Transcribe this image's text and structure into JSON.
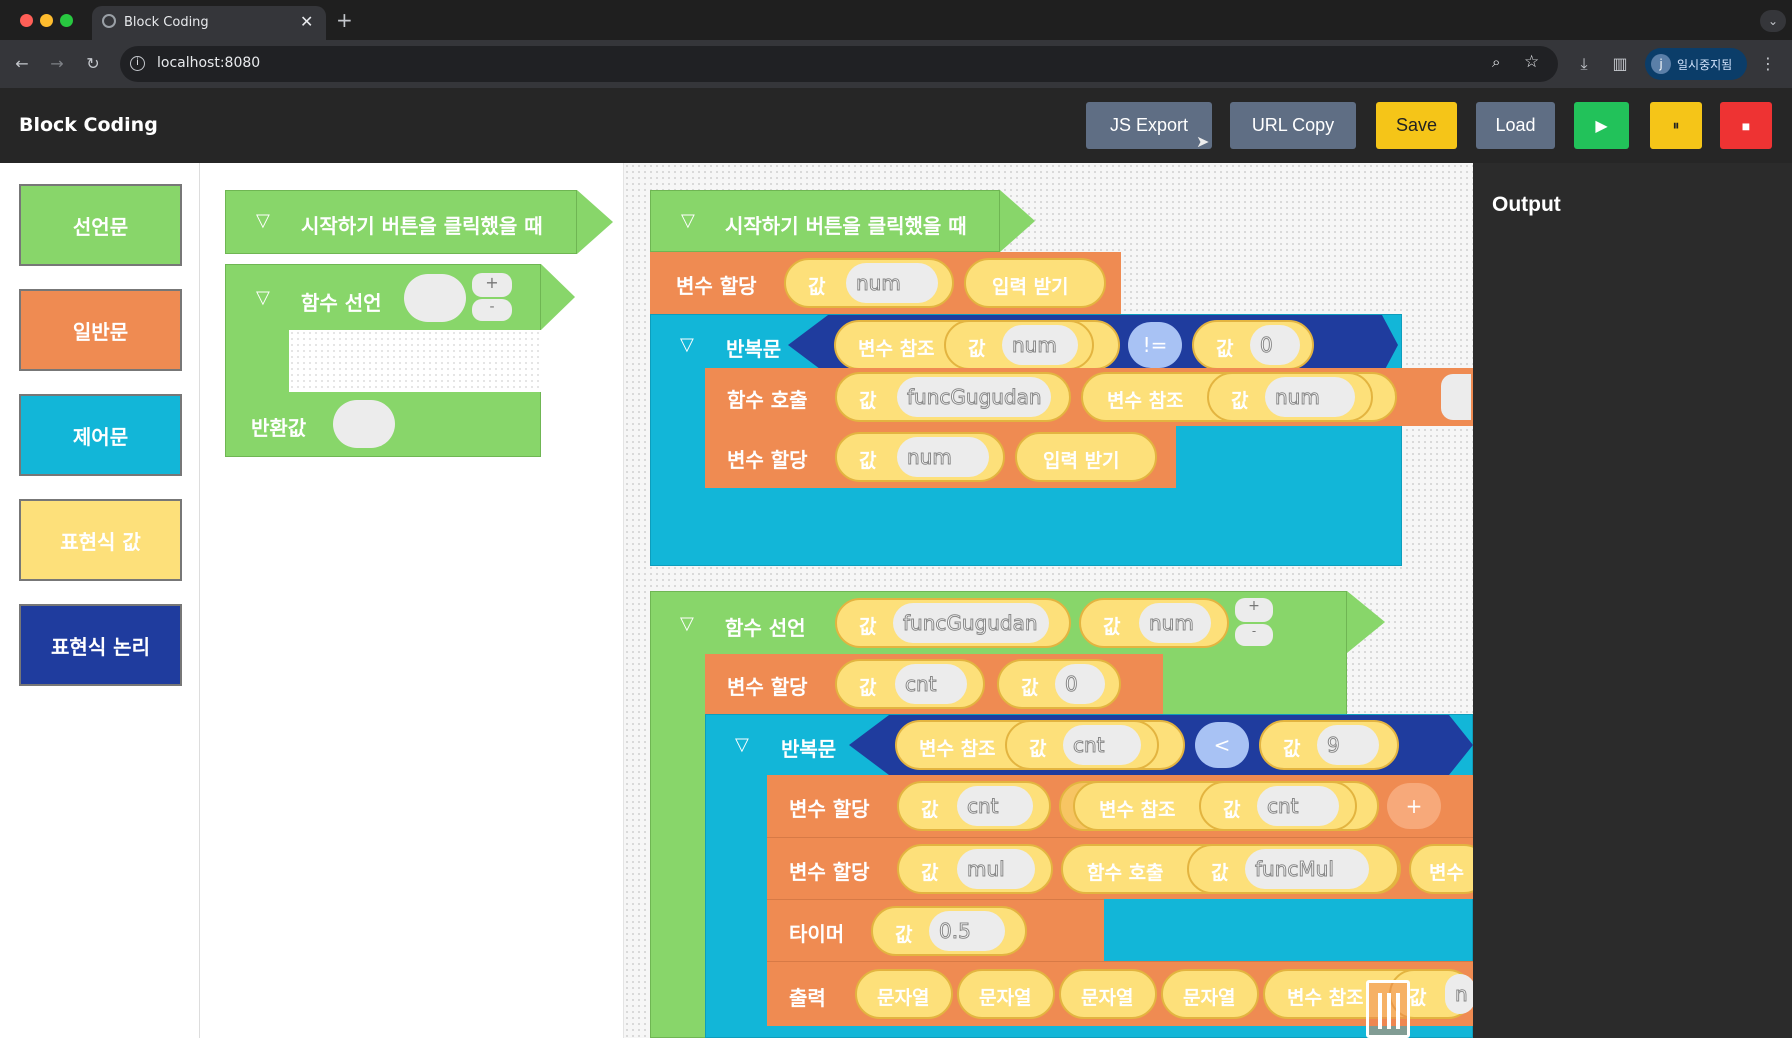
{
  "browser": {
    "tab_title": "Block Coding",
    "new_tab": "+",
    "url": "localhost:8080",
    "profile_initial": "j",
    "profile_label": "일시중지됨"
  },
  "app": {
    "title": "Block Coding",
    "buttons": {
      "js_export": "JS Export",
      "url_copy": "URL Copy",
      "save": "Save",
      "load": "Load",
      "run": "▶",
      "pause": "⏸",
      "stop": "■"
    },
    "colors": {
      "statement": "#88d66a",
      "general": "#ef8b52",
      "control": "#12b6d8",
      "expr_value": "#fde07a",
      "expr_logic": "#1f3c9e",
      "save": "#f5c518",
      "run": "#22c25a",
      "pause": "#f5c518",
      "stop": "#ee3333"
    }
  },
  "palette": {
    "categories": [
      "선언문",
      "일반문",
      "제어문",
      "표현식 값",
      "표현식 논리"
    ]
  },
  "flyout": {
    "start_block": "시작하기 버튼을 클릭했을 때",
    "func_decl": "함수 선언",
    "plus": "+",
    "minus": "-",
    "return_label": "반환값"
  },
  "canvas": {
    "toggle": "▽",
    "start_block": "시작하기 버튼을 클릭했을 때",
    "assign": "변수 할당",
    "value": "값",
    "input": "입력 받기",
    "loop": "반복문",
    "var_ref": "변수 참조",
    "func_call": "함수 호출",
    "func_decl": "함수 선언",
    "timer": "타이머",
    "print": "출력",
    "string": "문자열",
    "num": "num",
    "cnt": "cnt",
    "mul": "mul",
    "zero": "0",
    "nine": "9",
    "half": "0.5",
    "funcGugudan": "funcGugudan",
    "funcMul": "funcMul",
    "op_neq": "!=",
    "op_lt": "<",
    "op_plus": "+",
    "var_partial": "변수",
    "value_partial": "n"
  },
  "output": {
    "title": "Output"
  }
}
